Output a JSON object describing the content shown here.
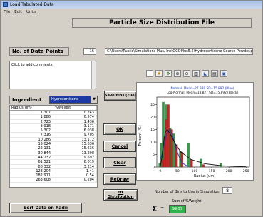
{
  "window": {
    "title": "Load Tabulated Data"
  },
  "menu": [
    "File",
    "Edit",
    "Units"
  ],
  "header": {
    "title": "Particle Size Distribution File"
  },
  "data_points": {
    "label": "No. of Data Points",
    "value": "16"
  },
  "file_path": "C:\\Users\\Public\\Simulations Plus, Inc\\GCOPlus5.5\\Hydrocortisone Coarse Powder.psd",
  "comments": {
    "placeholder": "Click to add comments"
  },
  "ingredient": {
    "label": "Ingredient",
    "selected": "Hydrocortisone"
  },
  "table": {
    "columns": [
      "Radius(um)",
      "%Weight"
    ],
    "rows": [
      [
        "1.307",
        "0.243"
      ],
      [
        "1.886",
        "0.574"
      ],
      [
        "2.723",
        "1.436"
      ],
      [
        "3.918",
        "3.171"
      ],
      [
        "5.302",
        "6.038"
      ],
      [
        "7.316",
        "9.705"
      ],
      [
        "10.286",
        "13.172"
      ],
      [
        "15.024",
        "15.636"
      ],
      [
        "22.131",
        "15.636"
      ],
      [
        "30.844",
        "13.298"
      ],
      [
        "44.232",
        "9.692"
      ],
      [
        "61.521",
        "6.019"
      ],
      [
        "88.332",
        "3.214"
      ],
      [
        "123.204",
        "1.41"
      ],
      [
        "182.911",
        "0.54"
      ],
      [
        "263.608",
        "0.204"
      ]
    ]
  },
  "buttons": {
    "save_bins": "Save Bins (File)",
    "ok": "OK",
    "cancel": "Cancel",
    "clear": "Clear",
    "redraw": "ReDraw",
    "fit": "Fit Distribution",
    "sort": "Sort Data on Radii"
  },
  "chart_data": {
    "type": "bar",
    "annotations": [
      "Normal: Mean=27.339 SD=15.892 (Blue)",
      "Log-Normal: Mean=18.827 SD=15.892 (Black)"
    ],
    "xlabel": "Radius [um]",
    "ylabel": "Percent [%]",
    "xlim": [
      -10,
      260
    ],
    "ylim": [
      0,
      28
    ],
    "xticks": [
      "0",
      "50",
      "100",
      "150",
      "200",
      "250"
    ],
    "yticks": [
      "0",
      "5",
      "10",
      "15",
      "20",
      "25"
    ],
    "series": [
      {
        "name": "green",
        "color": "#2ea043",
        "x": [
          2,
          7,
          12,
          22,
          32,
          42,
          62,
          85,
          122,
          180
        ],
        "values": [
          1.5,
          9.7,
          26,
          25,
          15.6,
          13.3,
          6.2,
          9.7,
          3.2,
          1.4
        ]
      },
      {
        "name": "red",
        "color": "#cc2222",
        "x": [
          4,
          10,
          15,
          20,
          30,
          44,
          60,
          88,
          122
        ],
        "values": [
          3,
          12,
          19,
          25,
          15,
          9,
          6,
          3,
          1
        ]
      }
    ],
    "lines": [
      {
        "name": "Normal",
        "color": "#1a3cc8",
        "x": [
          0,
          5,
          10,
          15,
          20,
          27,
          35,
          45,
          55,
          65,
          80
        ],
        "y": [
          3,
          5,
          8,
          11,
          13.5,
          15,
          13,
          8,
          4,
          1.5,
          0.3
        ]
      },
      {
        "name": "Log-Normal",
        "color": "#111111",
        "x": [
          0,
          5,
          10,
          15,
          20,
          30,
          45,
          60,
          90,
          130,
          180,
          250
        ],
        "y": [
          0,
          4,
          10,
          14,
          15,
          13,
          9,
          6,
          3,
          1.3,
          0.5,
          0.1
        ]
      }
    ]
  },
  "bins": {
    "label": "Number of Bins to Use in Simulation",
    "value": "8"
  },
  "sum": {
    "label": "Sum of %Weight",
    "symbol": "Σ",
    "equals": "=",
    "value": "99.99"
  }
}
